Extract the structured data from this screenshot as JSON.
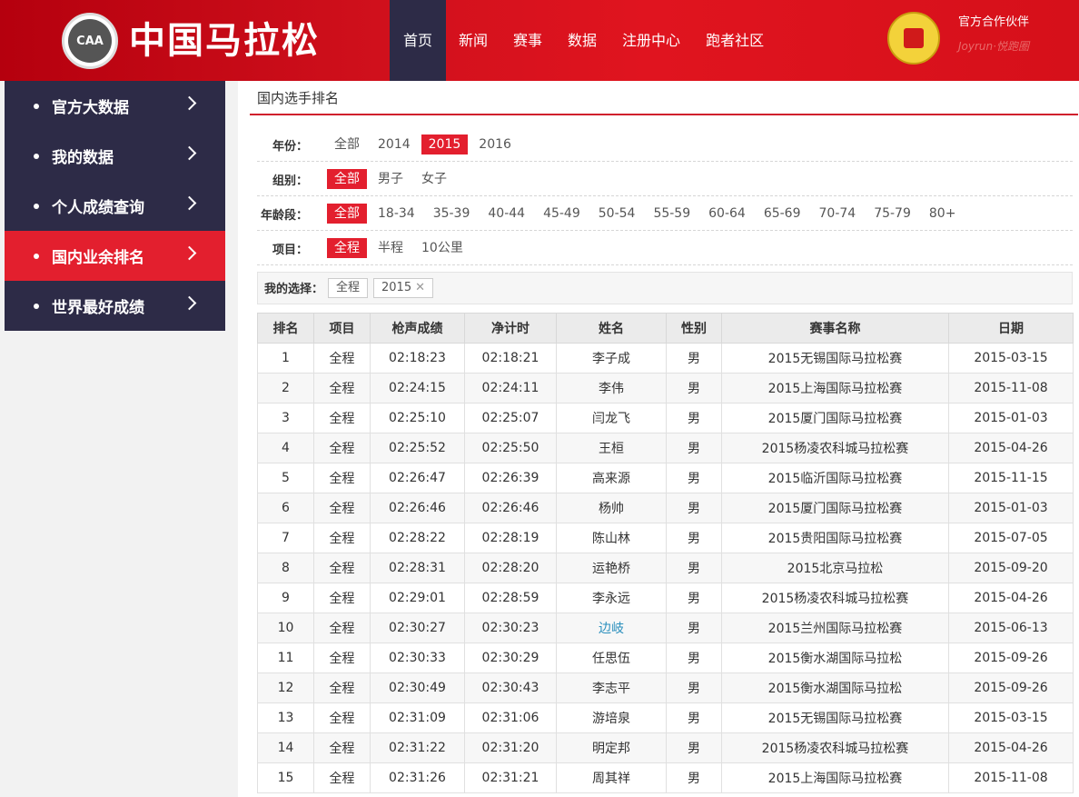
{
  "header": {
    "logo_badge": "CAA",
    "logo_text": "中国马拉松",
    "nav": [
      "首页",
      "新闻",
      "赛事",
      "数据",
      "注册中心",
      "跑者社区"
    ],
    "partner_label": "官方合作伙伴",
    "partner_sub": "Joyrun·悦跑圈"
  },
  "sidebar": {
    "items": [
      {
        "label": "官方大数据",
        "active": false
      },
      {
        "label": "我的数据",
        "active": false
      },
      {
        "label": "个人成绩查询",
        "active": false
      },
      {
        "label": "国内业余排名",
        "active": true
      },
      {
        "label": "世界最好成绩",
        "active": false
      }
    ]
  },
  "main": {
    "title": "国内选手排名",
    "filters": [
      {
        "label": "年份：",
        "options": [
          "全部",
          "2014",
          "2015",
          "2016"
        ],
        "selected": 2
      },
      {
        "label": "组别：",
        "options": [
          "全部",
          "男子",
          "女子"
        ],
        "selected": 0
      },
      {
        "label": "年龄段：",
        "options": [
          "全部",
          "18-34",
          "35-39",
          "40-44",
          "45-49",
          "50-54",
          "55-59",
          "60-64",
          "65-69",
          "70-74",
          "75-79",
          "80+"
        ],
        "selected": 0
      },
      {
        "label": "项目：",
        "options": [
          "全程",
          "半程",
          "10公里"
        ],
        "selected": 0
      }
    ],
    "choice_label": "我的选择：",
    "choice_tags": [
      "全程",
      "2015"
    ]
  },
  "table": {
    "headers": [
      "排名",
      "项目",
      "枪声成绩",
      "净计时",
      "姓名",
      "性别",
      "赛事名称",
      "日期"
    ],
    "rows": [
      [
        "1",
        "全程",
        "02:18:23",
        "02:18:21",
        "李子成",
        "男",
        "2015无锡国际马拉松赛",
        "2015-03-15"
      ],
      [
        "2",
        "全程",
        "02:24:15",
        "02:24:11",
        "李伟",
        "男",
        "2015上海国际马拉松赛",
        "2015-11-08"
      ],
      [
        "3",
        "全程",
        "02:25:10",
        "02:25:07",
        "闫龙飞",
        "男",
        "2015厦门国际马拉松赛",
        "2015-01-03"
      ],
      [
        "4",
        "全程",
        "02:25:52",
        "02:25:50",
        "王桓",
        "男",
        "2015杨凌农科城马拉松赛",
        "2015-04-26"
      ],
      [
        "5",
        "全程",
        "02:26:47",
        "02:26:39",
        "高来源",
        "男",
        "2015临沂国际马拉松赛",
        "2015-11-15"
      ],
      [
        "6",
        "全程",
        "02:26:46",
        "02:26:46",
        "杨帅",
        "男",
        "2015厦门国际马拉松赛",
        "2015-01-03"
      ],
      [
        "7",
        "全程",
        "02:28:22",
        "02:28:19",
        "陈山林",
        "男",
        "2015贵阳国际马拉松赛",
        "2015-07-05"
      ],
      [
        "8",
        "全程",
        "02:28:31",
        "02:28:20",
        "运艳桥",
        "男",
        "2015北京马拉松",
        "2015-09-20"
      ],
      [
        "9",
        "全程",
        "02:29:01",
        "02:28:59",
        "李永远",
        "男",
        "2015杨凌农科城马拉松赛",
        "2015-04-26"
      ],
      [
        "10",
        "全程",
        "02:30:27",
        "02:30:23",
        "边岐",
        "男",
        "2015兰州国际马拉松赛",
        "2015-06-13"
      ],
      [
        "11",
        "全程",
        "02:30:33",
        "02:30:29",
        "任思伍",
        "男",
        "2015衡水湖国际马拉松",
        "2015-09-26"
      ],
      [
        "12",
        "全程",
        "02:30:49",
        "02:30:43",
        "李志平",
        "男",
        "2015衡水湖国际马拉松",
        "2015-09-26"
      ],
      [
        "13",
        "全程",
        "02:31:09",
        "02:31:06",
        "游培泉",
        "男",
        "2015无锡国际马拉松赛",
        "2015-03-15"
      ],
      [
        "14",
        "全程",
        "02:31:22",
        "02:31:20",
        "明定邦",
        "男",
        "2015杨凌农科城马拉松赛",
        "2015-04-26"
      ],
      [
        "15",
        "全程",
        "02:31:26",
        "02:31:21",
        "周其祥",
        "男",
        "2015上海国际马拉松赛",
        "2015-11-08"
      ]
    ],
    "linked_name_rows": [
      9
    ]
  }
}
